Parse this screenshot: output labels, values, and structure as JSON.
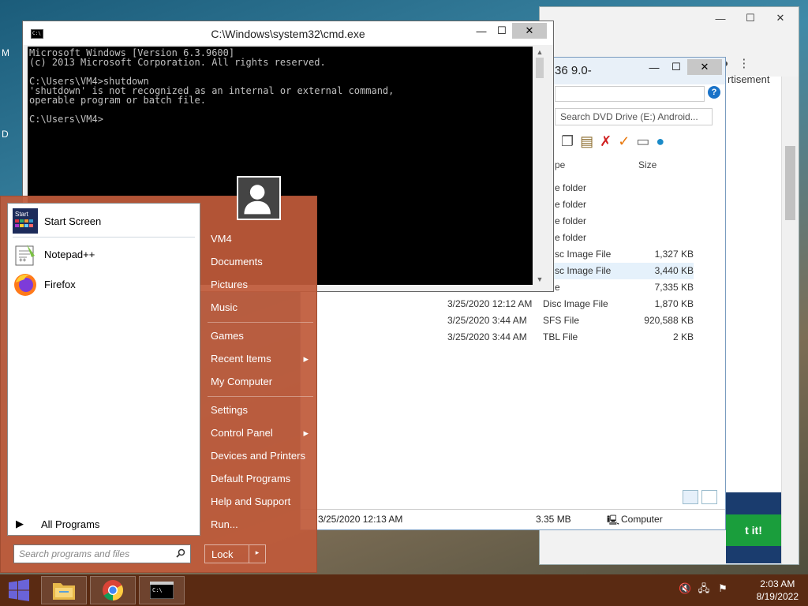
{
  "desktop": {
    "edge_letters": [
      "M",
      "D"
    ]
  },
  "browser": {
    "ad_fragment": "rtisement",
    "cta_fragment": "t it!",
    "toolbar_icons": [
      "share-icon",
      "star-icon",
      "reading-list-icon",
      "profile-icon",
      "menu-icon"
    ]
  },
  "explorer": {
    "title_fragment": "36 9.0-",
    "search_placeholder": "Search DVD Drive (E:) Android...",
    "columns": {
      "type": "pe",
      "size": "Size"
    },
    "rows": [
      {
        "date": "",
        "type": "e folder",
        "size": ""
      },
      {
        "date": "",
        "type": "e folder",
        "size": ""
      },
      {
        "date": "",
        "type": "e folder",
        "size": ""
      },
      {
        "date": "",
        "type": "e folder",
        "size": ""
      },
      {
        "date": "",
        "type": "sc Image File",
        "size": "1,327 KB"
      },
      {
        "date": "",
        "type": "sc Image File",
        "size": "3,440 KB"
      },
      {
        "date": "",
        "type": "e",
        "size": "7,335 KB"
      },
      {
        "date": "3/25/2020 12:12 AM",
        "type": "Disc Image File",
        "size": "1,870 KB"
      },
      {
        "date": "3/25/2020 3:44 AM",
        "type": "SFS File",
        "size": "920,588 KB"
      },
      {
        "date": "3/25/2020 3:44 AM",
        "type": "TBL File",
        "size": "2 KB"
      }
    ],
    "status": {
      "date": "3/25/2020 12:13 AM",
      "size": "3.35 MB",
      "location": "Computer"
    }
  },
  "cmd": {
    "title": "C:\\Windows\\system32\\cmd.exe",
    "icon_text": "C:\\",
    "lines": [
      "Microsoft Windows [Version 6.3.9600]",
      "(c) 2013 Microsoft Corporation. All rights reserved.",
      "",
      "C:\\Users\\VM4>shutdown",
      "'shutdown' is not recognized as an internal or external command,",
      "operable program or batch file.",
      "",
      "C:\\Users\\VM4>"
    ]
  },
  "startmenu": {
    "programs": [
      {
        "label": "Start Screen",
        "icon": "start-screen-icon",
        "badge": "Start"
      },
      {
        "label": "Notepad++",
        "icon": "notepad-plus-plus-icon"
      },
      {
        "label": "Firefox",
        "icon": "firefox-icon"
      }
    ],
    "all_programs": "All Programs",
    "search_placeholder": "Search programs and files",
    "right_items": [
      {
        "label": "VM4",
        "arrow": ""
      },
      {
        "label": "Documents",
        "arrow": ""
      },
      {
        "label": "Pictures",
        "arrow": ""
      },
      {
        "label": "Music",
        "arrow": ""
      },
      {
        "label": "Games",
        "arrow": ""
      },
      {
        "label": "Recent Items",
        "arrow": "▸"
      },
      {
        "label": "My Computer",
        "arrow": ""
      },
      {
        "label": "Settings",
        "arrow": ""
      },
      {
        "label": "Control Panel",
        "arrow": "▸"
      },
      {
        "label": "Devices and Printers",
        "arrow": ""
      },
      {
        "label": "Default Programs",
        "arrow": ""
      },
      {
        "label": "Help and Support",
        "arrow": ""
      },
      {
        "label": "Run...",
        "arrow": ""
      }
    ],
    "lock_label": "Lock",
    "lock_arrow": "▸"
  },
  "taskbar": {
    "time": "2:03 AM",
    "date": "8/19/2022",
    "colors": {
      "bar": "#5a2a12",
      "start_menu": "#c05a3a"
    }
  }
}
